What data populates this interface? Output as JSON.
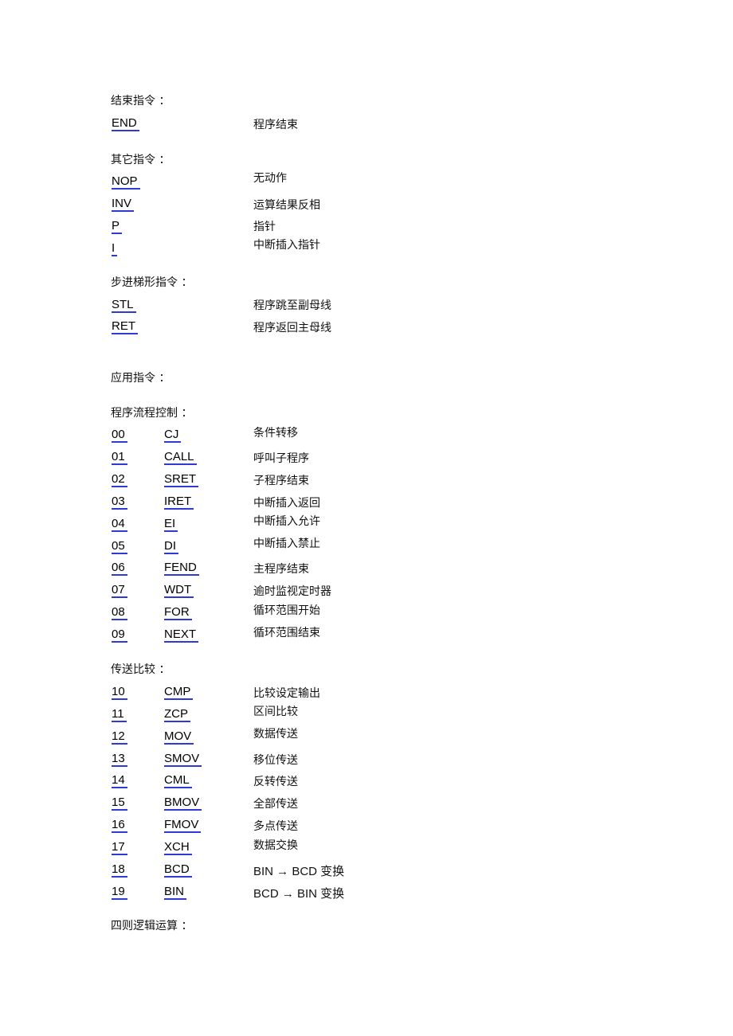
{
  "sections": {
    "end": {
      "heading": "结束指令 ：",
      "items": [
        {
          "code": "END",
          "desc": "程序结束"
        }
      ]
    },
    "other": {
      "heading": "其它指令 ：",
      "items": [
        {
          "code": "NOP",
          "desc": "无动作"
        },
        {
          "code": "INV",
          "desc": "运算结果反相"
        },
        {
          "code": "P",
          "desc": "指针"
        },
        {
          "code": "I",
          "desc": "中断插入指针"
        }
      ]
    },
    "step": {
      "heading": "步进梯形指令 ：",
      "items": [
        {
          "code": "STL",
          "desc": "程序跳至副母线"
        },
        {
          "code": "RET",
          "desc": "程序返回主母线"
        }
      ]
    },
    "applied": {
      "heading": "应用指令 ："
    },
    "flow": {
      "heading": "程序流程控制 ：",
      "items": [
        {
          "num": "00",
          "code": "CJ",
          "desc": "条件转移"
        },
        {
          "num": "01",
          "code": "CALL",
          "desc": "呼叫子程序"
        },
        {
          "num": "02",
          "code": "SRET",
          "desc": "子程序结束"
        },
        {
          "num": "03",
          "code": "IRET",
          "desc": "中断插入返回"
        },
        {
          "num": "04",
          "code": "EI",
          "desc": "中断插入允许"
        },
        {
          "num": "05",
          "code": "DI",
          "desc": "中断插入禁止"
        },
        {
          "num": "06",
          "code": "FEND",
          "desc": "主程序结束"
        },
        {
          "num": "07",
          "code": "WDT",
          "desc": "逾时监视定时器"
        },
        {
          "num": "08",
          "code": "FOR",
          "desc": "循环范围开始"
        },
        {
          "num": "09",
          "code": "NEXT",
          "desc": "循环范围结束"
        }
      ]
    },
    "transfer": {
      "heading": "传送比较 ：",
      "items": [
        {
          "num": "10",
          "code": "CMP",
          "desc": "比较设定输出"
        },
        {
          "num": "11",
          "code": "ZCP",
          "desc": "区间比较"
        },
        {
          "num": "12",
          "code": "MOV",
          "desc": "数据传送"
        },
        {
          "num": "13",
          "code": "SMOV",
          "desc": "移位传送"
        },
        {
          "num": "14",
          "code": "CML",
          "desc": "反转传送"
        },
        {
          "num": "15",
          "code": "BMOV",
          "desc": "全部传送"
        },
        {
          "num": "16",
          "code": "FMOV",
          "desc": "多点传送"
        },
        {
          "num": "17",
          "code": "XCH",
          "desc": "数据交换"
        },
        {
          "num": "18",
          "code": "BCD",
          "desc": "BIN  →  BCD  变换"
        },
        {
          "num": "19",
          "code": "BIN",
          "desc": "BCD  →  BIN  变换"
        }
      ]
    },
    "arith": {
      "heading": "四则逻辑运算 ："
    }
  },
  "colors": {
    "link_underline": "#2f3ad6"
  }
}
